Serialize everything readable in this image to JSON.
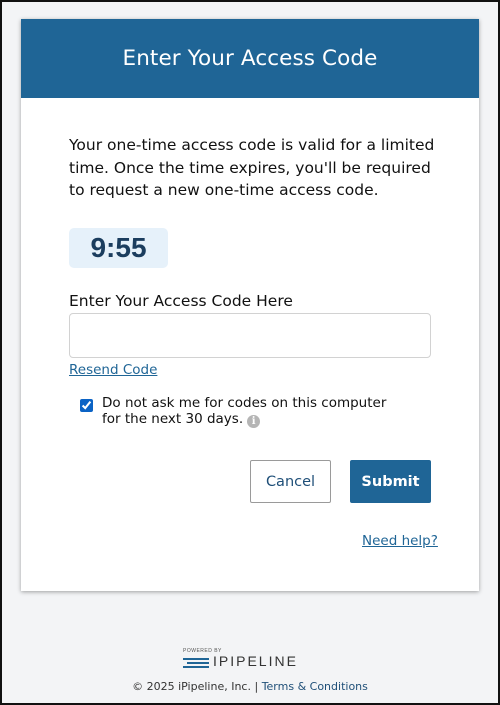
{
  "header": {
    "title": "Enter Your Access Code"
  },
  "intro": {
    "text": "Your one-time access code is valid for a limited time. Once the time expires, you'll be required to request a new one-time access code."
  },
  "timer": {
    "value": "9:55"
  },
  "form": {
    "label": "Enter Your Access Code Here",
    "code_value": "",
    "resend_label": "Resend Code",
    "remember_text": "Do not ask me for codes on this computer for the next 30 days.",
    "remember_checked": true,
    "info_icon": "info-icon"
  },
  "buttons": {
    "cancel_label": "Cancel",
    "submit_label": "Submit"
  },
  "help": {
    "label": "Need help?"
  },
  "footer": {
    "powered_by": "POWERED BY",
    "logo_text": "IPIPELINE",
    "copyright": "© 2025 iPipeline, Inc. |",
    "terms_label": "Terms & Conditions"
  },
  "colors": {
    "brand": "#1f6596",
    "timer_bg": "#e6f1fa",
    "link": "#1f6596"
  }
}
